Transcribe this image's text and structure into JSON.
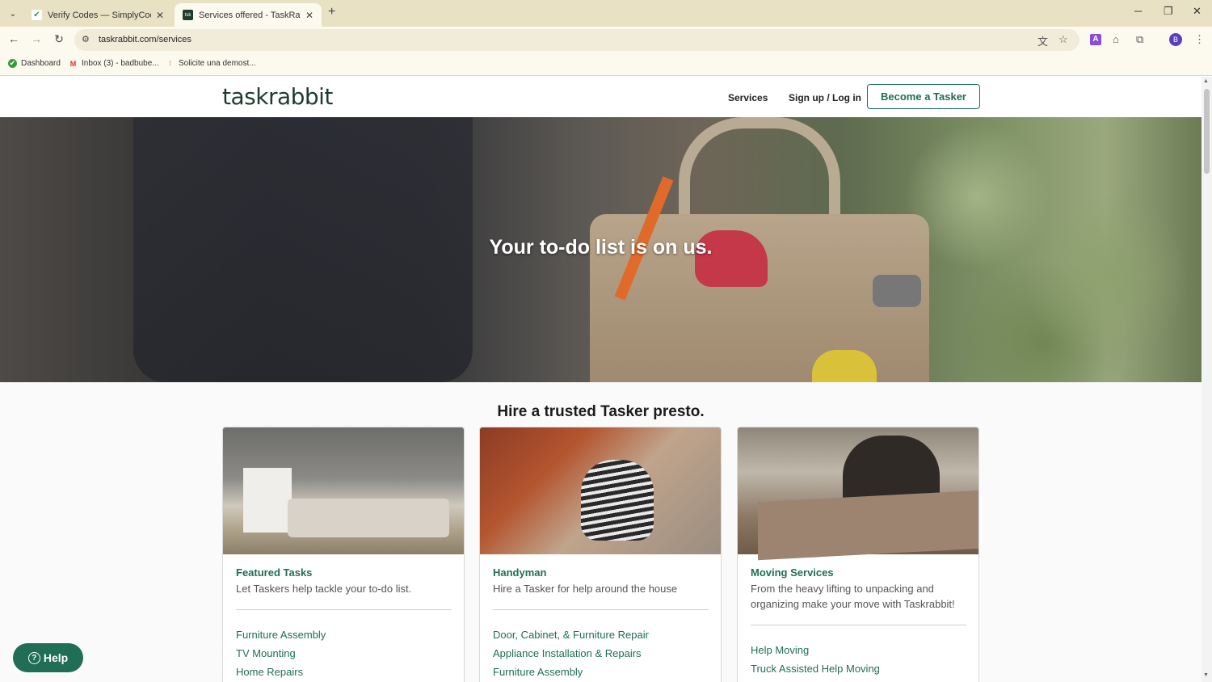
{
  "browser": {
    "tabs": [
      {
        "title": "Verify Codes — SimplyCodes",
        "active": false
      },
      {
        "title": "Services offered - TaskRabbit",
        "active": true
      }
    ],
    "url": "taskrabbit.com/services",
    "bookmarks": [
      "Dashboard",
      "Inbox (3) - badbube...",
      "Solicite una demost..."
    ],
    "profile_initial": "B",
    "extension_letter": "A"
  },
  "header": {
    "logo": "taskrabbit",
    "nav": {
      "services": "Services",
      "signup": "Sign up / Log in",
      "become": "Become a Tasker"
    }
  },
  "hero": {
    "headline": "Your to-do list is on us."
  },
  "section": {
    "heading": "Hire a trusted Tasker presto.",
    "cards": [
      {
        "title": "Featured Tasks",
        "description": "Let Taskers help tackle your to-do list.",
        "links": [
          "Furniture Assembly",
          "TV Mounting",
          "Home Repairs"
        ]
      },
      {
        "title": "Handyman",
        "description": "Hire a Tasker for help around the house",
        "links": [
          "Door, Cabinet, & Furniture Repair",
          "Appliance Installation & Repairs",
          "Furniture Assembly"
        ]
      },
      {
        "title": "Moving Services",
        "description": "From the heavy lifting to unpacking and organizing make your move with Taskrabbit!",
        "links": [
          "Help Moving",
          "Truck Assisted Help Moving"
        ]
      }
    ]
  },
  "help_button": {
    "label": "Help"
  },
  "colors": {
    "brand_green": "#1f6e55",
    "logo": "#1f3c2e"
  }
}
